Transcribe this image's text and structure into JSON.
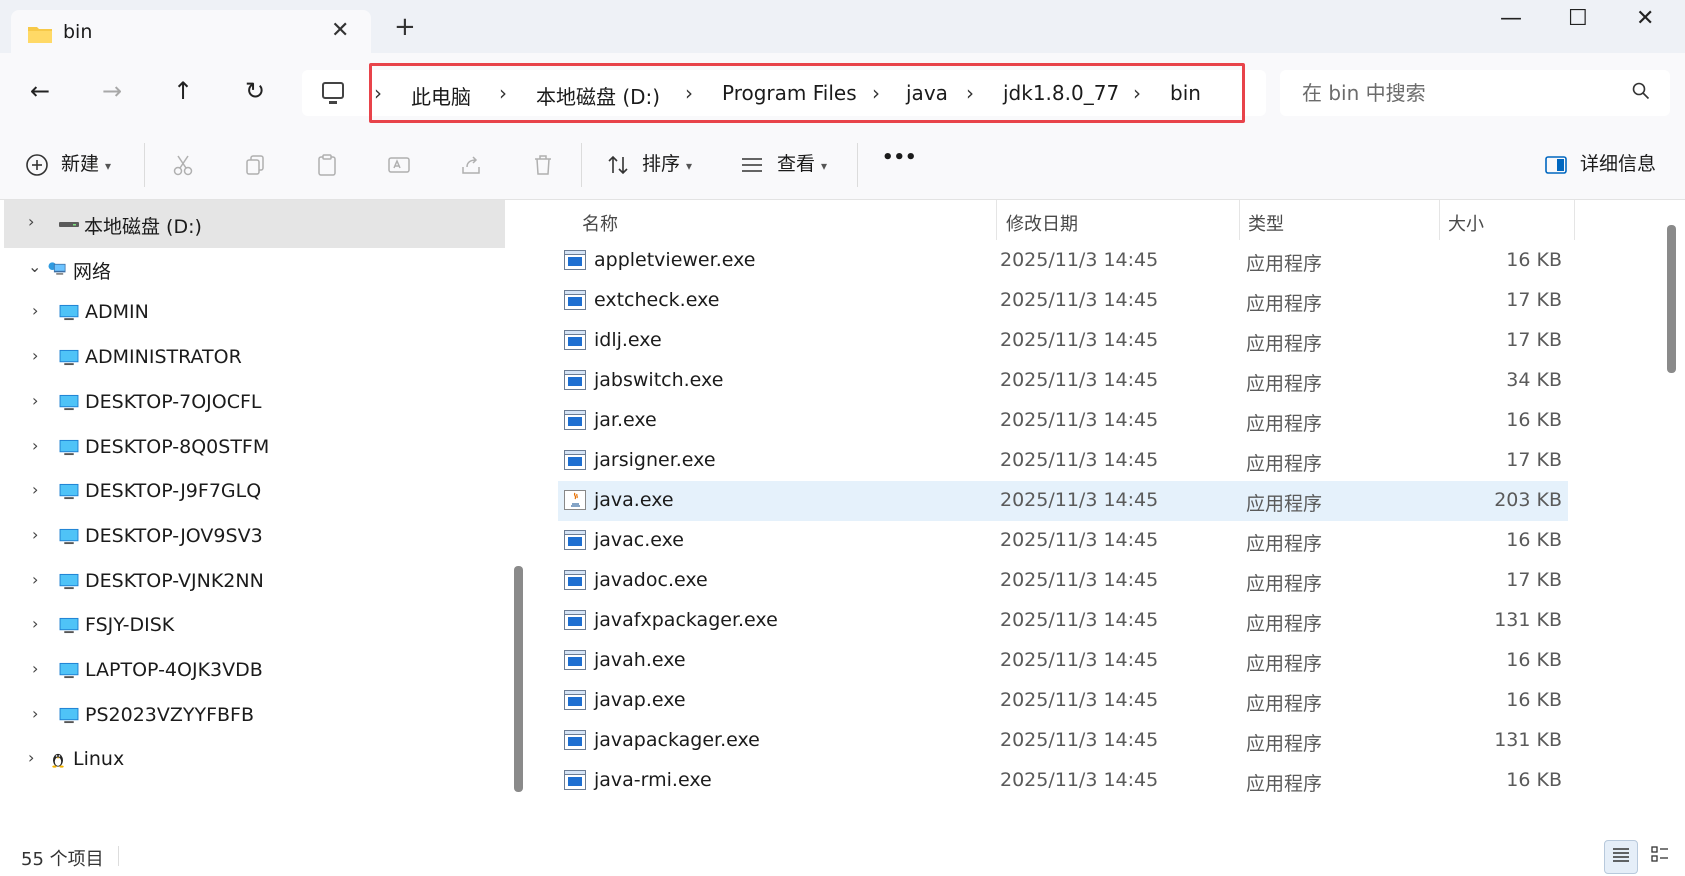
{
  "tab": {
    "title": "bin",
    "close": "✕",
    "new": "+"
  },
  "window": {
    "minimize": "—",
    "maximize": "☐",
    "close": "✕"
  },
  "nav": {
    "back": "←",
    "forward": "→",
    "up": "↑",
    "refresh": "↻"
  },
  "breadcrumb": [
    "此电脑",
    "本地磁盘 (D:)",
    "Program Files",
    "java",
    "jdk1.8.0_77",
    "bin"
  ],
  "breadcrumb_sep": "›",
  "search": {
    "placeholder": "在 bin 中搜索",
    "icon": "search-icon"
  },
  "toolbar": {
    "new_label": "新建",
    "sort_label": "排序",
    "view_label": "查看",
    "more_label": "•••",
    "details_label": "详细信息"
  },
  "sidebar": {
    "items": [
      {
        "label": "本地磁盘 (D:)",
        "icon": "drive-icon",
        "chevron": "›",
        "selected": true
      },
      {
        "label": "网络",
        "icon": "network-icon",
        "chevron": "⌄",
        "selected": false
      },
      {
        "label": "ADMIN",
        "icon": "monitor-icon",
        "chevron": "›"
      },
      {
        "label": "ADMINISTRATOR",
        "icon": "monitor-icon",
        "chevron": "›"
      },
      {
        "label": "DESKTOP-7OJOCFL",
        "icon": "monitor-icon",
        "chevron": "›"
      },
      {
        "label": "DESKTOP-8Q0STFM",
        "icon": "monitor-icon",
        "chevron": "›"
      },
      {
        "label": "DESKTOP-J9F7GLQ",
        "icon": "monitor-icon",
        "chevron": "›"
      },
      {
        "label": "DESKTOP-JOV9SV3",
        "icon": "monitor-icon",
        "chevron": "›"
      },
      {
        "label": "DESKTOP-VJNK2NN",
        "icon": "monitor-icon",
        "chevron": "›"
      },
      {
        "label": "FSJY-DISK",
        "icon": "monitor-icon",
        "chevron": "›"
      },
      {
        "label": "LAPTOP-4OJK3VDB",
        "icon": "monitor-icon",
        "chevron": "›"
      },
      {
        "label": "PS2023VZYYFBFB",
        "icon": "monitor-icon",
        "chevron": "›"
      },
      {
        "label": "Linux",
        "icon": "linux-penguin-icon",
        "chevron": "›"
      }
    ]
  },
  "columns": {
    "name": "名称",
    "date": "修改日期",
    "type": "类型",
    "size": "大小"
  },
  "files": [
    {
      "name": "appletviewer.exe",
      "date": "2025/11/3 14:45",
      "type": "应用程序",
      "size": "16 KB"
    },
    {
      "name": "extcheck.exe",
      "date": "2025/11/3 14:45",
      "type": "应用程序",
      "size": "17 KB"
    },
    {
      "name": "idlj.exe",
      "date": "2025/11/3 14:45",
      "type": "应用程序",
      "size": "17 KB"
    },
    {
      "name": "jabswitch.exe",
      "date": "2025/11/3 14:45",
      "type": "应用程序",
      "size": "34 KB"
    },
    {
      "name": "jar.exe",
      "date": "2025/11/3 14:45",
      "type": "应用程序",
      "size": "16 KB"
    },
    {
      "name": "jarsigner.exe",
      "date": "2025/11/3 14:45",
      "type": "应用程序",
      "size": "17 KB"
    },
    {
      "name": "java.exe",
      "date": "2025/11/3 14:45",
      "type": "应用程序",
      "size": "203 KB",
      "selected": true,
      "java_icon": true
    },
    {
      "name": "javac.exe",
      "date": "2025/11/3 14:45",
      "type": "应用程序",
      "size": "16 KB"
    },
    {
      "name": "javadoc.exe",
      "date": "2025/11/3 14:45",
      "type": "应用程序",
      "size": "17 KB"
    },
    {
      "name": "javafxpackager.exe",
      "date": "2025/11/3 14:45",
      "type": "应用程序",
      "size": "131 KB"
    },
    {
      "name": "javah.exe",
      "date": "2025/11/3 14:45",
      "type": "应用程序",
      "size": "16 KB"
    },
    {
      "name": "javap.exe",
      "date": "2025/11/3 14:45",
      "type": "应用程序",
      "size": "16 KB"
    },
    {
      "name": "javapackager.exe",
      "date": "2025/11/3 14:45",
      "type": "应用程序",
      "size": "131 KB"
    },
    {
      "name": "java-rmi.exe",
      "date": "2025/11/3 14:45",
      "type": "应用程序",
      "size": "16 KB"
    }
  ],
  "status": {
    "count": "55 个项目"
  },
  "colors": {
    "highlight_border": "#e8434a",
    "selection": "#e5f1fb",
    "accent": "#0067c0"
  }
}
